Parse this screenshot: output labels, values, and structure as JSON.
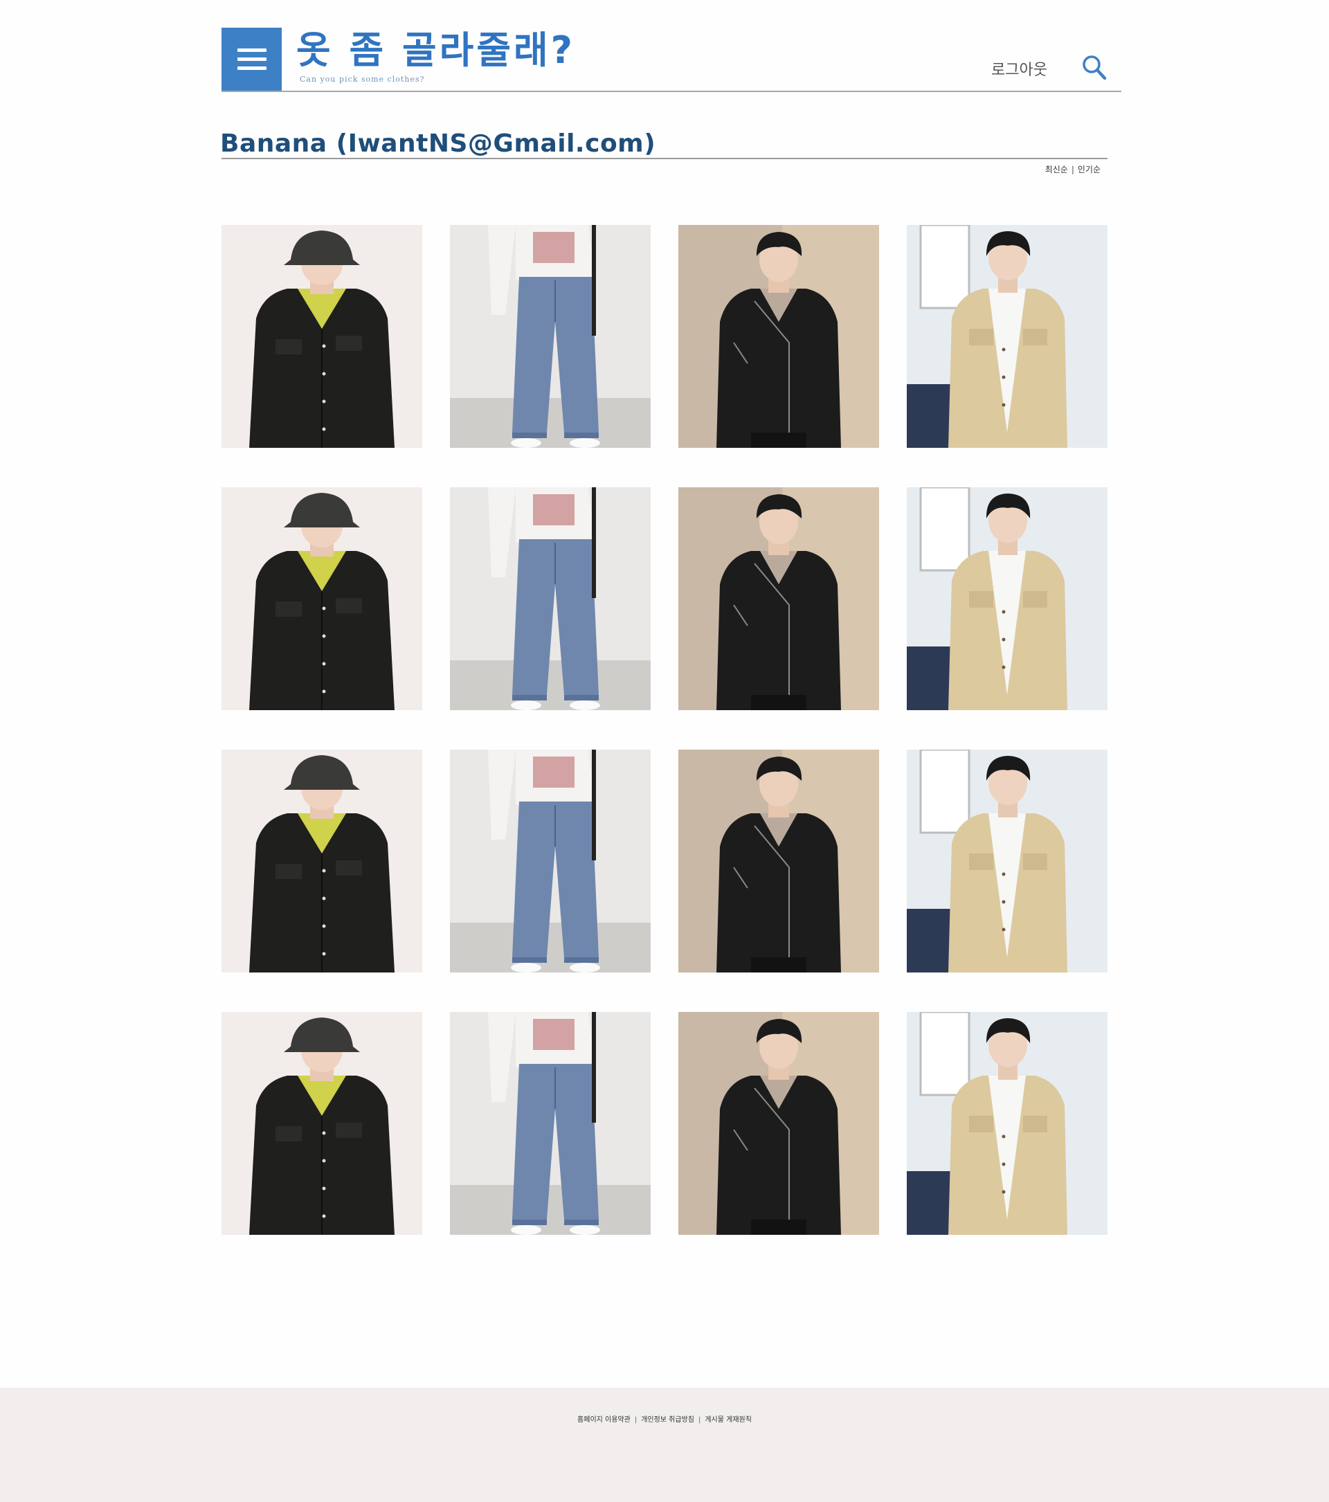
{
  "header": {
    "logo_title": "옷 좀 골라줄래?",
    "logo_subtitle": "Can you pick some clothes?",
    "logout_label": "로그아웃",
    "brand_color": "#3d80c6",
    "menu_icon": "hamburger-menu-icon",
    "search_icon": "magnifier-icon"
  },
  "profile": {
    "title": "Banana (IwantNS@Gmail.com)",
    "sort_options": [
      "최신순",
      "인기순"
    ]
  },
  "grid": {
    "rows": 4,
    "columns": 4,
    "items": [
      {
        "photo": "black-shirt-jacket-bucket-hat"
      },
      {
        "photo": "wide-blue-jeans-white-sweatshirt"
      },
      {
        "photo": "black-leather-rider-jacket"
      },
      {
        "photo": "beige-cotton-trucker-jacket"
      }
    ]
  },
  "footer": {
    "links": [
      "홈페이지 이용약관",
      "개인정보 취급방침",
      "게시물 게재원칙"
    ]
  }
}
